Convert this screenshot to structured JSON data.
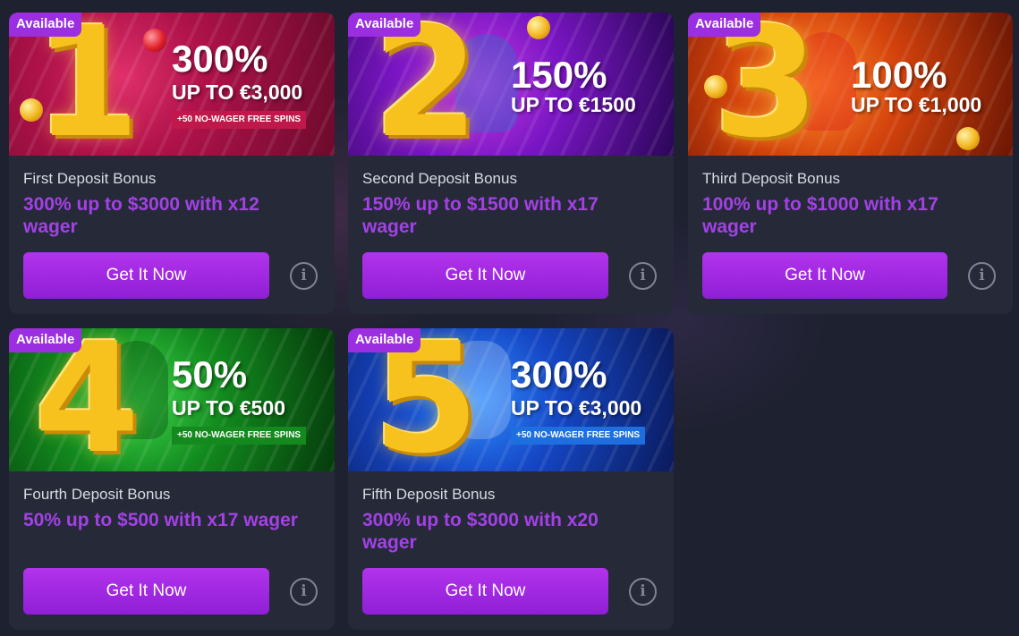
{
  "colors": {
    "accent": "#a341e6",
    "button": "#9b28e2",
    "badge": "#9a2ee0",
    "card_bg": "#252938",
    "page_bg": "#1e2130"
  },
  "cards": [
    {
      "badge": "Available",
      "banner_number": "1",
      "banner_percent": "300%",
      "banner_upto": "UP TO €3,000",
      "banner_spins": "+50 NO-WAGER FREE SPINS",
      "title": "First Deposit Bonus",
      "description": "300% up to $3000 with x12 wager",
      "button": "Get It Now",
      "info_icon": "info-icon"
    },
    {
      "badge": "Available",
      "banner_number": "2",
      "banner_percent": "150%",
      "banner_upto": "UP TO €1500",
      "title": "Second Deposit Bonus",
      "description": "150% up to $1500 with x17 wager",
      "button": "Get It Now",
      "info_icon": "info-icon"
    },
    {
      "badge": "Available",
      "banner_number": "3",
      "banner_percent": "100%",
      "banner_upto": "UP TO €1,000",
      "title": "Third Deposit Bonus",
      "description": "100% up to $1000 with x17 wager",
      "button": "Get It Now",
      "info_icon": "info-icon"
    },
    {
      "badge": "Available",
      "banner_number": "4",
      "banner_percent": "50%",
      "banner_upto": "UP TO €500",
      "banner_spins": "+50 NO-WAGER FREE SPINS",
      "title": "Fourth Deposit Bonus",
      "description": "50% up to $500 with x17 wager",
      "button": "Get It Now",
      "info_icon": "info-icon"
    },
    {
      "badge": "Available",
      "banner_number": "5",
      "banner_percent": "300%",
      "banner_upto": "UP TO €3,000",
      "banner_spins": "+50 NO-WAGER FREE SPINS",
      "title": "Fifth Deposit Bonus",
      "description": "300% up to $3000 with x20 wager",
      "button": "Get It Now",
      "info_icon": "info-icon"
    }
  ]
}
